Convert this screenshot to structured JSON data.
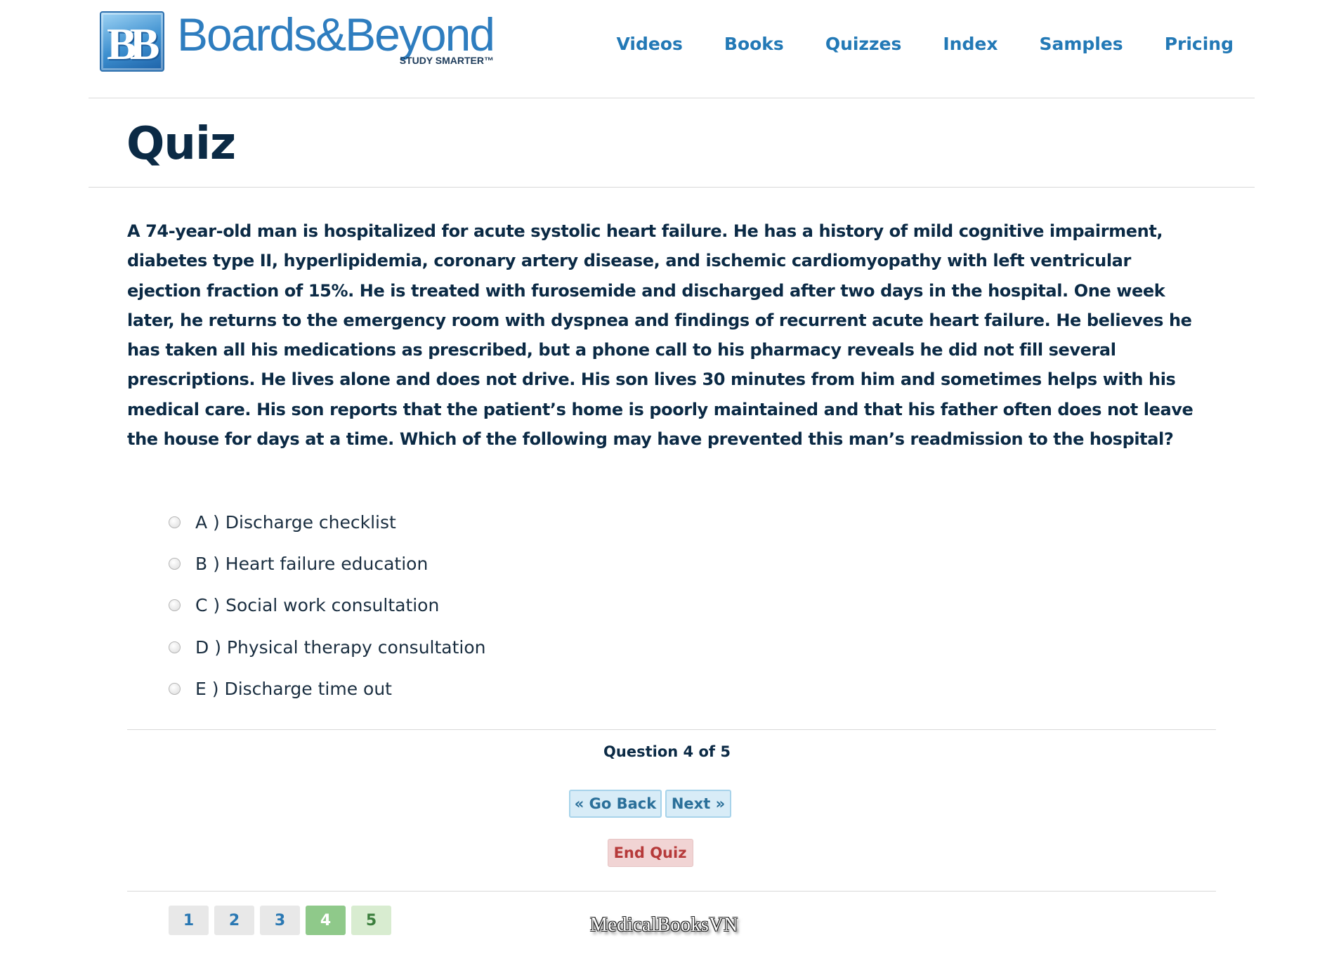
{
  "brand": {
    "mark": "BB",
    "name": "Boards&Beyond",
    "tagline": "STUDY SMARTER™"
  },
  "nav": {
    "items": [
      {
        "label": "Videos"
      },
      {
        "label": "Books"
      },
      {
        "label": "Quizzes"
      },
      {
        "label": "Index"
      },
      {
        "label": "Samples"
      },
      {
        "label": "Pricing"
      }
    ]
  },
  "page": {
    "title": "Quiz"
  },
  "question": {
    "text": "A 74-year-old man is hospitalized for acute systolic heart failure. He has a history of mild cognitive impairment, diabetes type II, hyperlipidemia, coronary artery disease, and ischemic cardiomyopathy with left ventricular ejection fraction of 15%. He is treated with furosemide and discharged after two days in the hospital. One week later, he returns to the emergency room with dyspnea and findings of recurrent acute heart failure. He believes he has taken all his medications as prescribed, but a phone call to his pharmacy reveals he did not fill several prescriptions. He lives alone and does not drive. His son lives 30 minutes from him and sometimes helps with his medical care. His son reports that the patient’s home is poorly maintained and that his father often does not leave the house for days at a time. Which of the following may have prevented this man’s readmission to the hospital?",
    "options": [
      {
        "label": "A ) Discharge checklist"
      },
      {
        "label": "B ) Heart failure education"
      },
      {
        "label": "C ) Social work consultation"
      },
      {
        "label": "D ) Physical therapy consultation"
      },
      {
        "label": "E ) Discharge time out"
      }
    ]
  },
  "progress": {
    "text": "Question 4 of 5",
    "current": 4,
    "total": 5
  },
  "controls": {
    "back_label": "« Go Back",
    "next_label": "Next »",
    "end_label": "End Quiz"
  },
  "pager": {
    "pages": [
      "1",
      "2",
      "3",
      "4",
      "5"
    ]
  },
  "watermark": "MedicalBooksVN",
  "colors": {
    "brand_blue": "#2379b6",
    "heading_navy": "#0b2a45",
    "current_page_green": "#8fc98a",
    "end_quiz_red": "#b63a3a"
  }
}
